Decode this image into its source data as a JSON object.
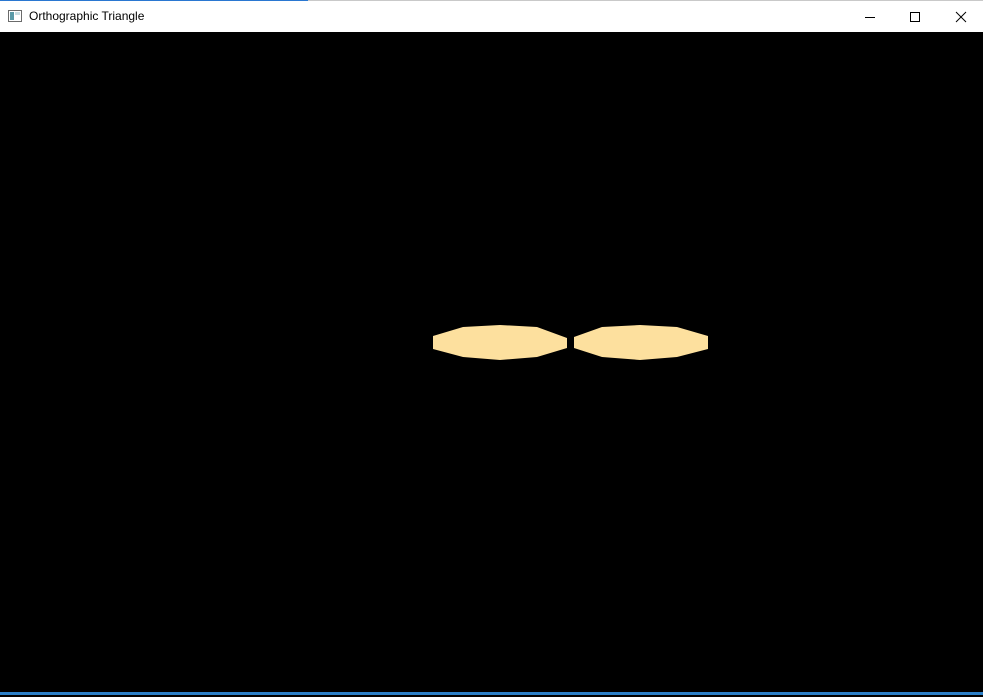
{
  "window": {
    "title": "Orthographic Triangle",
    "app_icon": "window-app-icon",
    "controls": {
      "minimize_icon": "minimize-icon",
      "maximize_icon": "maximize-icon",
      "close_icon": "close-icon"
    }
  },
  "scene": {
    "background_color": "#000000",
    "shape_color": "#fde09e",
    "shape_count": 2
  },
  "colors": {
    "taskbar_accent": "#2b7fc7",
    "titlebar_bg": "#ffffff"
  }
}
